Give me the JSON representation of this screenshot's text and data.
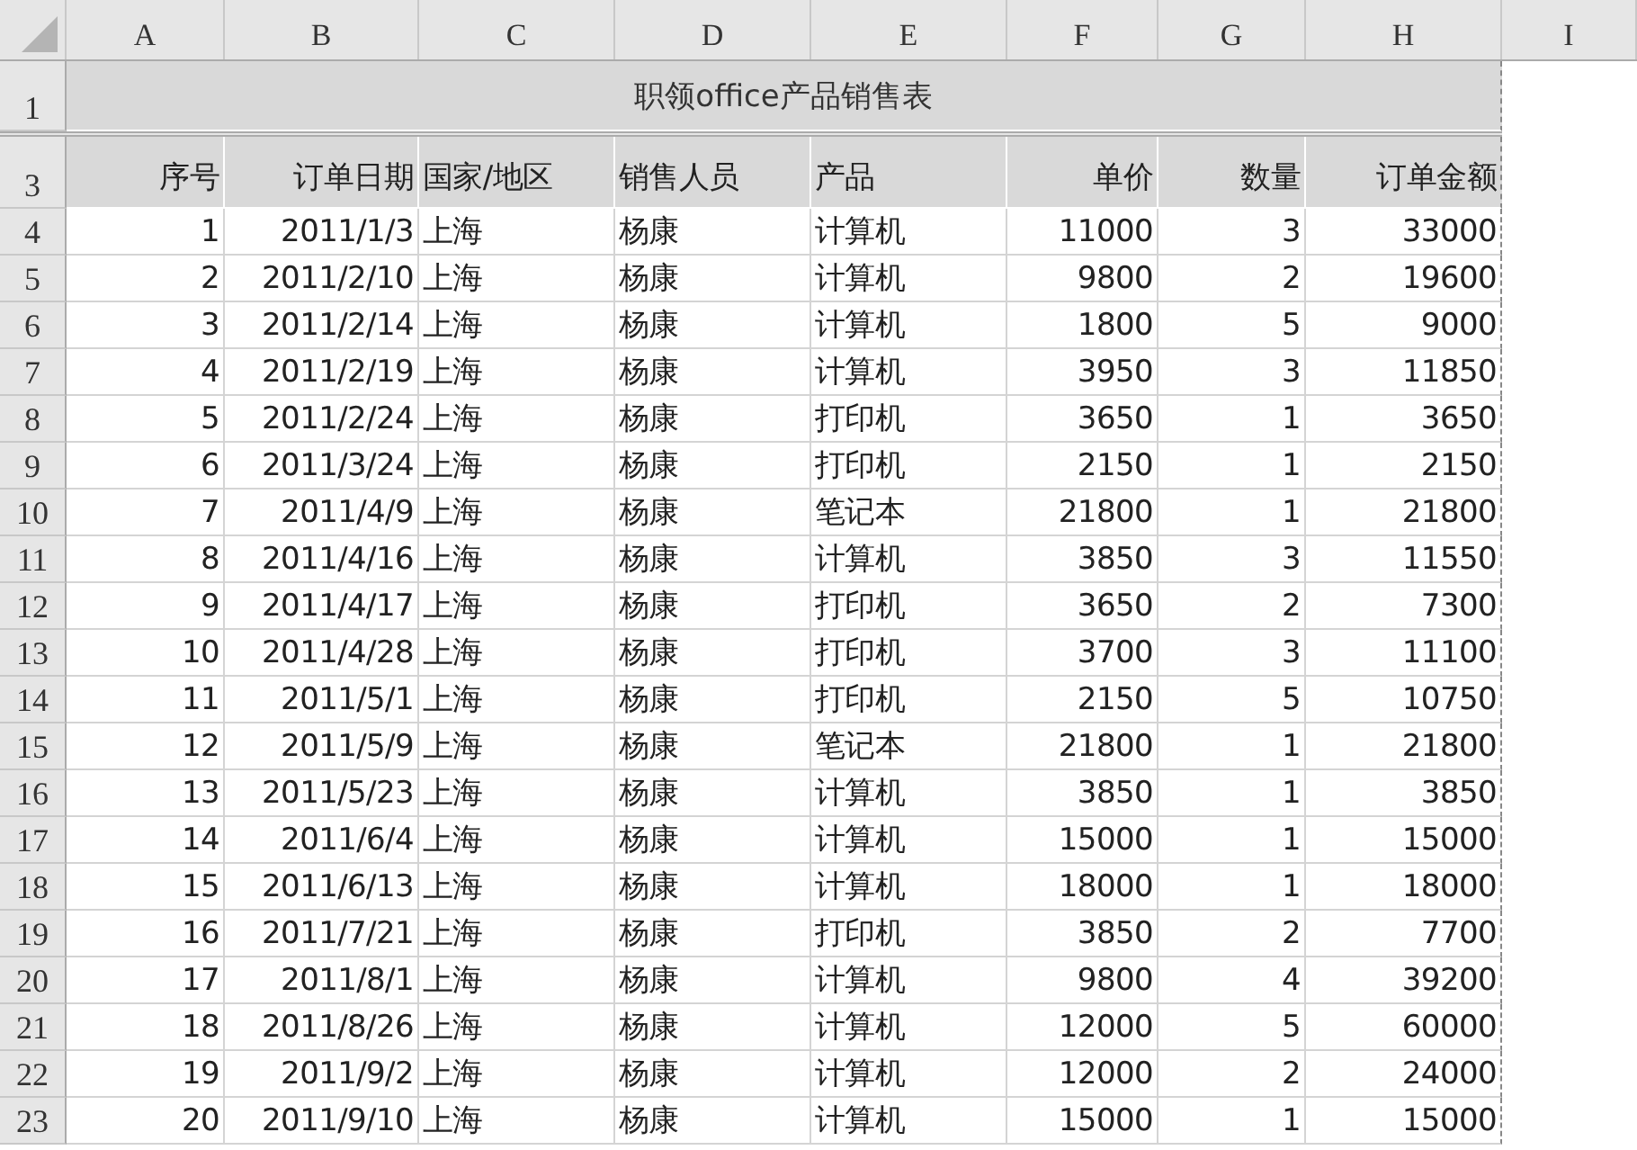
{
  "columns": [
    "A",
    "B",
    "C",
    "D",
    "E",
    "F",
    "G",
    "H",
    "I"
  ],
  "title": {
    "row": "1",
    "text": "职领office产品销售表"
  },
  "header": {
    "row": "3",
    "cells": [
      "序号",
      "订单日期",
      "国家/地区",
      "销售人员",
      "产品",
      "单价",
      "数量",
      "订单金额"
    ]
  },
  "rows": [
    {
      "row": "4",
      "cells": [
        "1",
        "2011/1/3",
        "上海",
        "杨康",
        "计算机",
        "11000",
        "3",
        "33000"
      ]
    },
    {
      "row": "5",
      "cells": [
        "2",
        "2011/2/10",
        "上海",
        "杨康",
        "计算机",
        "9800",
        "2",
        "19600"
      ]
    },
    {
      "row": "6",
      "cells": [
        "3",
        "2011/2/14",
        "上海",
        "杨康",
        "计算机",
        "1800",
        "5",
        "9000"
      ]
    },
    {
      "row": "7",
      "cells": [
        "4",
        "2011/2/19",
        "上海",
        "杨康",
        "计算机",
        "3950",
        "3",
        "11850"
      ]
    },
    {
      "row": "8",
      "cells": [
        "5",
        "2011/2/24",
        "上海",
        "杨康",
        "打印机",
        "3650",
        "1",
        "3650"
      ]
    },
    {
      "row": "9",
      "cells": [
        "6",
        "2011/3/24",
        "上海",
        "杨康",
        "打印机",
        "2150",
        "1",
        "2150"
      ]
    },
    {
      "row": "10",
      "cells": [
        "7",
        "2011/4/9",
        "上海",
        "杨康",
        "笔记本",
        "21800",
        "1",
        "21800"
      ]
    },
    {
      "row": "11",
      "cells": [
        "8",
        "2011/4/16",
        "上海",
        "杨康",
        "计算机",
        "3850",
        "3",
        "11550"
      ]
    },
    {
      "row": "12",
      "cells": [
        "9",
        "2011/4/17",
        "上海",
        "杨康",
        "打印机",
        "3650",
        "2",
        "7300"
      ]
    },
    {
      "row": "13",
      "cells": [
        "10",
        "2011/4/28",
        "上海",
        "杨康",
        "打印机",
        "3700",
        "3",
        "11100"
      ]
    },
    {
      "row": "14",
      "cells": [
        "11",
        "2011/5/1",
        "上海",
        "杨康",
        "打印机",
        "2150",
        "5",
        "10750"
      ]
    },
    {
      "row": "15",
      "cells": [
        "12",
        "2011/5/9",
        "上海",
        "杨康",
        "笔记本",
        "21800",
        "1",
        "21800"
      ]
    },
    {
      "row": "16",
      "cells": [
        "13",
        "2011/5/23",
        "上海",
        "杨康",
        "计算机",
        "3850",
        "1",
        "3850"
      ]
    },
    {
      "row": "17",
      "cells": [
        "14",
        "2011/6/4",
        "上海",
        "杨康",
        "计算机",
        "15000",
        "1",
        "15000"
      ]
    },
    {
      "row": "18",
      "cells": [
        "15",
        "2011/6/13",
        "上海",
        "杨康",
        "计算机",
        "18000",
        "1",
        "18000"
      ]
    },
    {
      "row": "19",
      "cells": [
        "16",
        "2011/7/21",
        "上海",
        "杨康",
        "打印机",
        "3850",
        "2",
        "7700"
      ]
    },
    {
      "row": "20",
      "cells": [
        "17",
        "2011/8/1",
        "上海",
        "杨康",
        "计算机",
        "9800",
        "4",
        "39200"
      ]
    },
    {
      "row": "21",
      "cells": [
        "18",
        "2011/8/26",
        "上海",
        "杨康",
        "计算机",
        "12000",
        "5",
        "60000"
      ]
    },
    {
      "row": "22",
      "cells": [
        "19",
        "2011/9/2",
        "上海",
        "杨康",
        "计算机",
        "12000",
        "2",
        "24000"
      ]
    },
    {
      "row": "23",
      "cells": [
        "20",
        "2011/9/10",
        "上海",
        "杨康",
        "计算机",
        "15000",
        "1",
        "15000"
      ]
    }
  ]
}
